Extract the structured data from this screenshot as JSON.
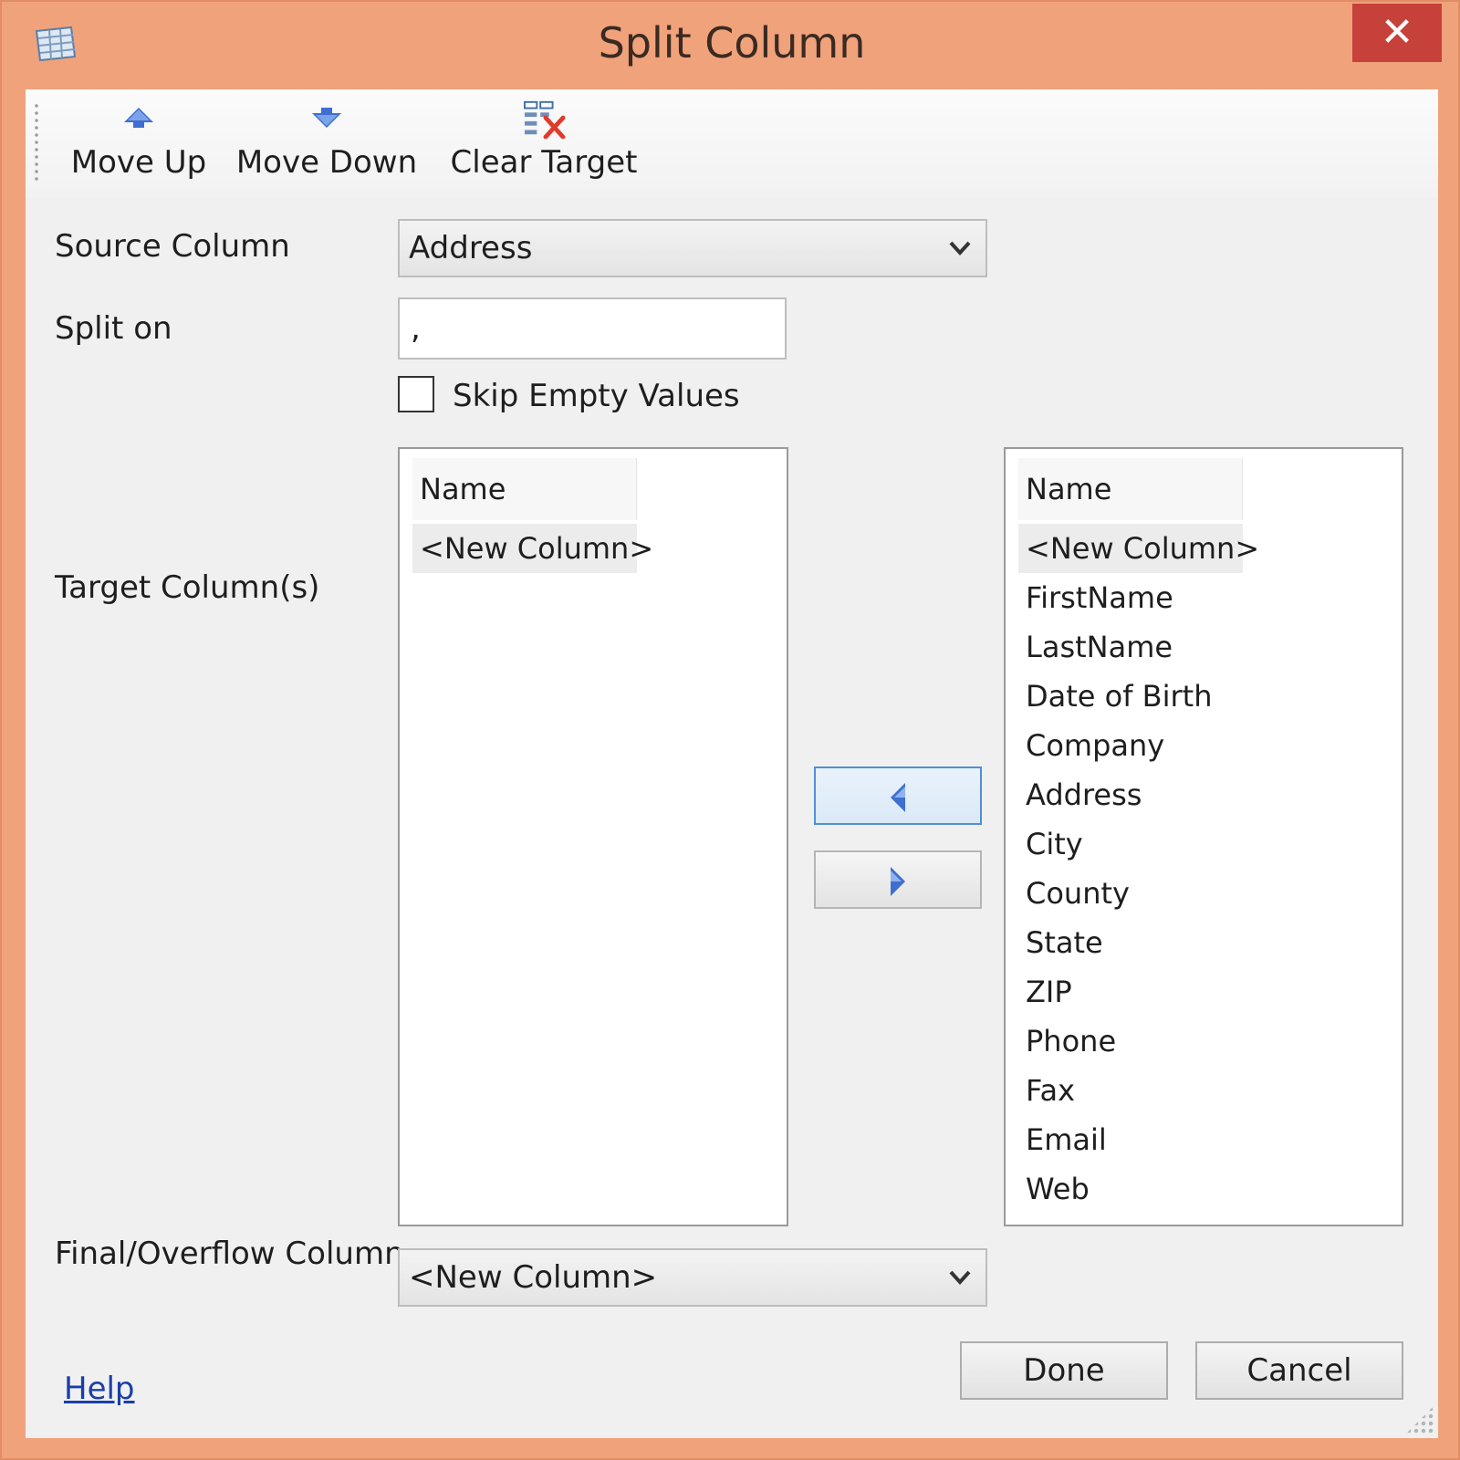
{
  "window": {
    "title": "Split Column",
    "close_glyph": "✕",
    "app_icon": "table-icon"
  },
  "toolbar": {
    "move_up": "Move Up",
    "move_down": "Move Down",
    "clear_target": "Clear Target"
  },
  "form": {
    "source_column_label": "Source Column",
    "source_column_value": "Address",
    "split_on_label": "Split on",
    "split_on_value": ",",
    "skip_empty_label": "Skip Empty Values",
    "skip_empty_checked": false,
    "target_columns_label": "Target Column(s)",
    "overflow_label": "Final/Overflow Column",
    "overflow_value": "<New Column>"
  },
  "target_list": {
    "header": "Name",
    "items": [
      "<New Column>"
    ]
  },
  "available_list": {
    "header": "Name",
    "items": [
      "<New Column>",
      "FirstName",
      "LastName",
      "Date of Birth",
      "Company",
      "Address",
      "City",
      "County",
      "State",
      "ZIP",
      "Phone",
      "Fax",
      "Email",
      "Web"
    ]
  },
  "buttons": {
    "done": "Done",
    "cancel": "Cancel",
    "help": "Help"
  },
  "colors": {
    "frame": "#f0a27b",
    "close": "#c7413b",
    "accent_blue": "#3f6fd0",
    "link": "#1a3fa8"
  }
}
